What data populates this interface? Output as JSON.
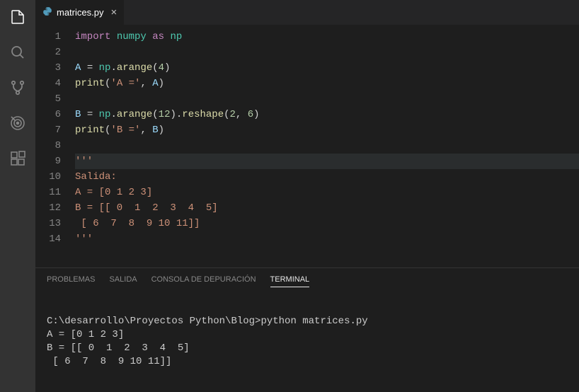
{
  "tab": {
    "filename": "matrices.py"
  },
  "code_lines": [
    {
      "n": "1",
      "html": "<span class='kw'>import</span> <span class='mod'>numpy</span> <span class='kw'>as</span> <span class='mod'>np</span>"
    },
    {
      "n": "2",
      "html": ""
    },
    {
      "n": "3",
      "html": "<span class='var'>A</span> <span class='punc'>=</span> <span class='mod'>np</span><span class='punc'>.</span><span class='fn'>arange</span><span class='punc'>(</span><span class='num'>4</span><span class='punc'>)</span>"
    },
    {
      "n": "4",
      "html": "<span class='fn'>print</span><span class='punc'>(</span><span class='str'>'A ='</span><span class='punc'>,</span> <span class='var'>A</span><span class='punc'>)</span>"
    },
    {
      "n": "5",
      "html": ""
    },
    {
      "n": "6",
      "html": "<span class='var'>B</span> <span class='punc'>=</span> <span class='mod'>np</span><span class='punc'>.</span><span class='fn'>arange</span><span class='punc'>(</span><span class='num'>12</span><span class='punc'>).</span><span class='fn'>reshape</span><span class='punc'>(</span><span class='num'>2</span><span class='punc'>,</span> <span class='num'>6</span><span class='punc'>)</span>"
    },
    {
      "n": "7",
      "html": "<span class='fn'>print</span><span class='punc'>(</span><span class='str'>'B ='</span><span class='punc'>,</span> <span class='var'>B</span><span class='punc'>)</span>"
    },
    {
      "n": "8",
      "html": ""
    },
    {
      "n": "9",
      "html": "<span class='str'>'''</span>",
      "current": true
    },
    {
      "n": "10",
      "html": "<span class='str'>Salida:</span>"
    },
    {
      "n": "11",
      "html": "<span class='str'>A = [0 1 2 3]</span>"
    },
    {
      "n": "12",
      "html": "<span class='str'>B = [[ 0  1  2  3  4  5]</span>"
    },
    {
      "n": "13",
      "html": "<span class='str'> [ 6  7  8  9 10 11]]</span>"
    },
    {
      "n": "14",
      "html": "<span class='str'>'''</span>"
    }
  ],
  "panel": {
    "tabs": [
      "PROBLEMAS",
      "SALIDA",
      "CONSOLA DE DEPURACIÓN",
      "TERMINAL"
    ],
    "active": 3
  },
  "terminal_lines": [
    "",
    "C:\\desarrollo\\Proyectos Python\\Blog>python matrices.py",
    "A = [0 1 2 3]",
    "B = [[ 0  1  2  3  4  5]",
    " [ 6  7  8  9 10 11]]"
  ]
}
